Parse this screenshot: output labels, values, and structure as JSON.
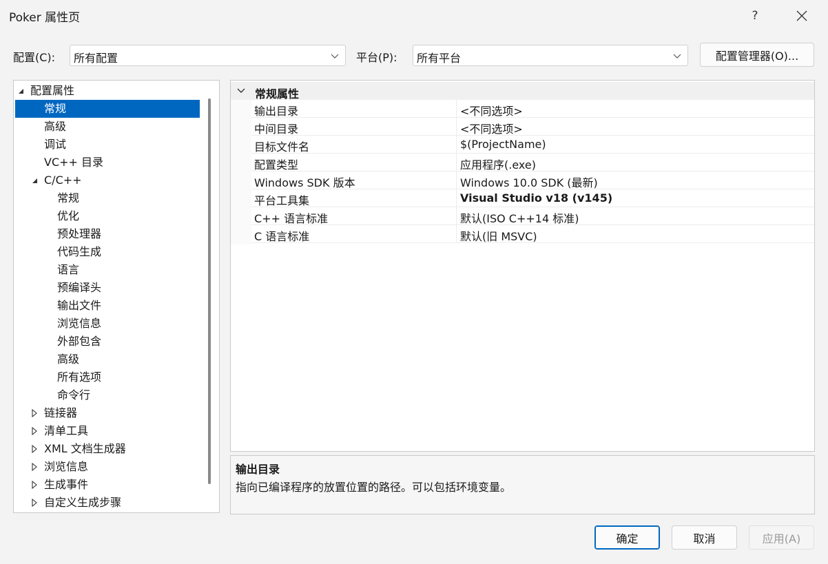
{
  "window": {
    "title": "Poker 属性页",
    "help_label": "?"
  },
  "toolbar": {
    "config_label": "配置(C):",
    "config_value": "所有配置",
    "platform_label": "平台(P):",
    "platform_value": "所有平台",
    "config_manager_label": "配置管理器(O)..."
  },
  "tree": [
    {
      "label": "配置属性",
      "expander": "expanded"
    },
    {
      "label": "常规",
      "expander": "none",
      "selected": true
    },
    {
      "label": "高级",
      "expander": "none"
    },
    {
      "label": "调试",
      "expander": "none"
    },
    {
      "label": "VC++ 目录",
      "expander": "none"
    },
    {
      "label": "C/C++",
      "expander": "expanded"
    },
    {
      "label": "常规",
      "expander": "none"
    },
    {
      "label": "优化",
      "expander": "none"
    },
    {
      "label": "预处理器",
      "expander": "none"
    },
    {
      "label": "代码生成",
      "expander": "none"
    },
    {
      "label": "语言",
      "expander": "none"
    },
    {
      "label": "预编译头",
      "expander": "none"
    },
    {
      "label": "输出文件",
      "expander": "none"
    },
    {
      "label": "浏览信息",
      "expander": "none"
    },
    {
      "label": "外部包含",
      "expander": "none"
    },
    {
      "label": "高级",
      "expander": "none"
    },
    {
      "label": "所有选项",
      "expander": "none"
    },
    {
      "label": "命令行",
      "expander": "none"
    },
    {
      "label": "链接器",
      "expander": "collapsed"
    },
    {
      "label": "清单工具",
      "expander": "collapsed"
    },
    {
      "label": "XML 文档生成器",
      "expander": "collapsed"
    },
    {
      "label": "浏览信息",
      "expander": "collapsed"
    },
    {
      "label": "生成事件",
      "expander": "collapsed"
    },
    {
      "label": "自定义生成步骤",
      "expander": "collapsed"
    }
  ],
  "grid": {
    "category": "常规属性",
    "properties": [
      {
        "name": "输出目录",
        "value": "<不同选项>"
      },
      {
        "name": "中间目录",
        "value": "<不同选项>"
      },
      {
        "name": "目标文件名",
        "value": "$(ProjectName)"
      },
      {
        "name": "配置类型",
        "value": "应用程序(.exe)"
      },
      {
        "name": "Windows SDK 版本",
        "value": "Windows 10.0 SDK (最新)"
      },
      {
        "name": "平台工具集",
        "value": "Visual Studio v18 (v145)",
        "bold": true
      },
      {
        "name": "C++ 语言标准",
        "value": "默认(ISO C++14 标准)"
      },
      {
        "name": "C 语言标准",
        "value": "默认(旧 MSVC)"
      }
    ]
  },
  "description": {
    "title": "输出目录",
    "text": "指向已编译程序的放置位置的路径。可以包括环境变量。"
  },
  "buttons": {
    "ok": "确定",
    "cancel": "取消",
    "apply": "应用(A)"
  },
  "colors": {
    "selection": "#0067c0",
    "window_bg": "#f3f3f3"
  }
}
